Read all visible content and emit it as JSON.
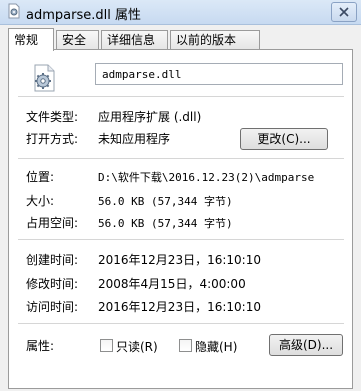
{
  "window": {
    "title": "admparse.dll 属性"
  },
  "tabs": [
    {
      "label": "常规",
      "active": true
    },
    {
      "label": "安全",
      "active": false
    },
    {
      "label": "详细信息",
      "active": false
    },
    {
      "label": "以前的版本",
      "active": false
    }
  ],
  "file": {
    "name": "admparse.dll",
    "icon": "dll-file-gear-icon"
  },
  "type_row": {
    "label": "文件类型:",
    "value": "应用程序扩展 (.dll)"
  },
  "opens_with": {
    "label": "打开方式:",
    "value": "未知应用程序",
    "change_button": "更改(C)..."
  },
  "location": {
    "label": "位置:",
    "value": "D:\\软件下载\\2016.12.23(2)\\admparse"
  },
  "size": {
    "label": "大小:",
    "value": "56.0 KB (57,344 字节)"
  },
  "size_on_disk": {
    "label": "占用空间:",
    "value": "56.0 KB (57,344 字节)"
  },
  "created": {
    "label": "创建时间:",
    "value": "2016年12月23日，16:10:10"
  },
  "modified": {
    "label": "修改时间:",
    "value": "2008年4月15日，4:00:00"
  },
  "accessed": {
    "label": "访问时间:",
    "value": "2016年12月23日，16:10:10"
  },
  "attributes": {
    "label": "属性:",
    "readonly": {
      "label": "只读(R)",
      "checked": false
    },
    "hidden": {
      "label": "隐藏(H)",
      "checked": false
    },
    "advanced_button": "高级(D)..."
  },
  "colors": {
    "titlebar": "#c7daf1",
    "panel": "#ffffff",
    "window_bg": "#f0f0f0"
  }
}
